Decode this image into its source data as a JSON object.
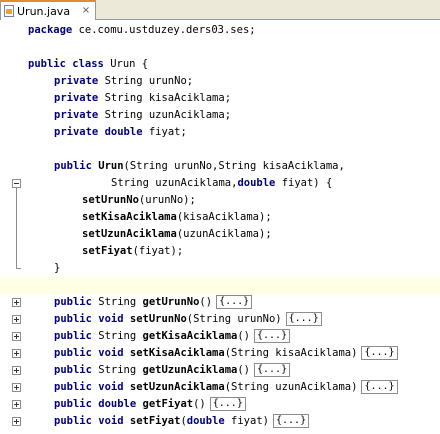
{
  "tab": {
    "title": "Urun.java",
    "close": "×"
  },
  "code": {
    "package_kw": "package",
    "package_name": " ce.comu.ustduzey.ders03.ses;",
    "class_kw1": "public",
    "class_kw2": " class",
    "class_name": " Urun {",
    "fields": [
      {
        "mod": "private",
        "rest": " String urunNo;"
      },
      {
        "mod": "private",
        "rest": " String kisaAciklama;"
      },
      {
        "mod": "private",
        "rest": " String uzunAciklama;"
      },
      {
        "mod": "private",
        "type": " double",
        "rest": " fiyat;"
      }
    ],
    "ctor_mod": "public",
    "ctor_name": " Urun",
    "ctor_params1": "(String urunNo,String kisaAciklama,",
    "ctor_params2a": "String uzunAciklama,",
    "ctor_params2_kw": "double",
    "ctor_params2b": " fiyat) {",
    "ctor_body": [
      {
        "name": "setUrunNo",
        "args": "(urunNo);"
      },
      {
        "name": "setKisaAciklama",
        "args": "(kisaAciklama);"
      },
      {
        "name": "setUzunAciklama",
        "args": "(uzunAciklama);"
      },
      {
        "name": "setFiyat",
        "args": "(fiyat);"
      }
    ],
    "close_brace": "}",
    "methods": [
      {
        "mod": "public",
        "ret": " String ",
        "ret_kw": false,
        "name": "getUrunNo",
        "params": "()",
        "fold": "{...}"
      },
      {
        "mod": "public",
        "ret": " void ",
        "ret_kw": true,
        "name": "setUrunNo",
        "params": "(String urunNo)",
        "fold": "{...}"
      },
      {
        "mod": "public",
        "ret": " String ",
        "ret_kw": false,
        "name": "getKisaAciklama",
        "params": "()",
        "fold": "{...}"
      },
      {
        "mod": "public",
        "ret": " void ",
        "ret_kw": true,
        "name": "setKisaAciklama",
        "params": "(String kisaAciklama)",
        "fold": "{...}"
      },
      {
        "mod": "public",
        "ret": " String ",
        "ret_kw": false,
        "name": "getUzunAciklama",
        "params": "()",
        "fold": "{...}"
      },
      {
        "mod": "public",
        "ret": " void ",
        "ret_kw": true,
        "name": "setUzunAciklama",
        "params": "(String uzunAciklama)",
        "fold": "{...}"
      },
      {
        "mod": "public",
        "ret": " double ",
        "ret_kw": true,
        "name": "getFiyat",
        "params": "()",
        "fold": "{...}"
      },
      {
        "mod": "public",
        "ret": " void ",
        "ret_kw": true,
        "name": "setFiyat",
        "params_a": "(",
        "params_kw": "double",
        "params_b": " fiyat)",
        "fold": "{...}"
      }
    ]
  }
}
